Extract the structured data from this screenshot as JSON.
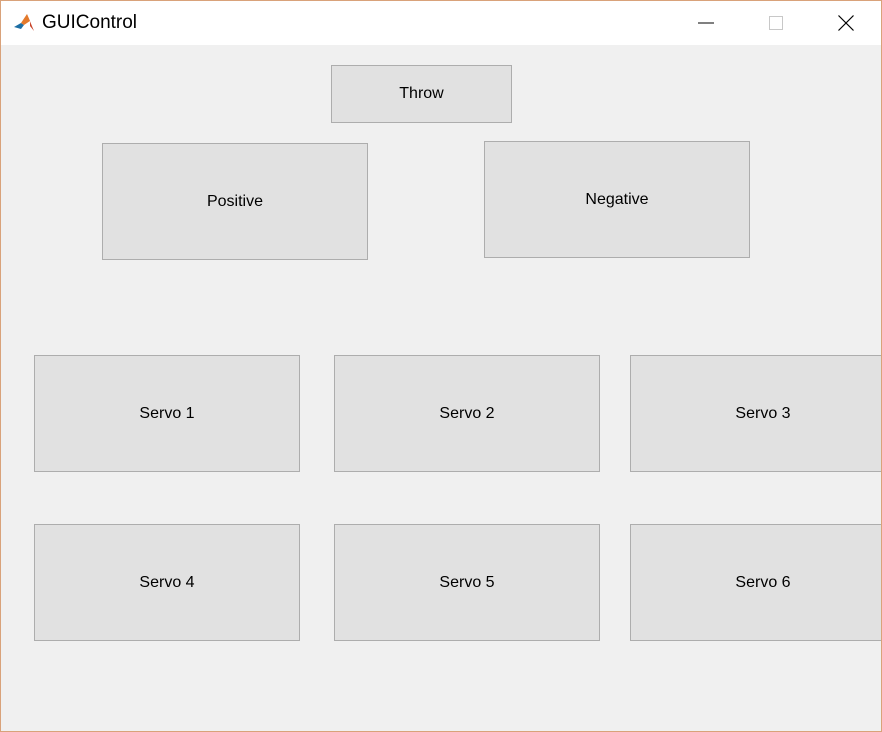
{
  "window": {
    "title": "GUIControl",
    "icon": "matlab-icon",
    "controls": {
      "minimize_icon": "minimize-icon",
      "maximize_icon": "maximize-icon",
      "close_icon": "close-icon"
    }
  },
  "buttons": {
    "throw": "Throw",
    "positive": "Positive",
    "negative": "Negative",
    "servo1": "Servo 1",
    "servo2": "Servo 2",
    "servo3": "Servo 3",
    "servo4": "Servo 4",
    "servo5": "Servo 5",
    "servo6": "Servo 6"
  },
  "colors": {
    "background": "#f0f0f0",
    "button_face": "#e1e1e1",
    "button_border": "#adadad",
    "window_border": "#d9a27a"
  }
}
